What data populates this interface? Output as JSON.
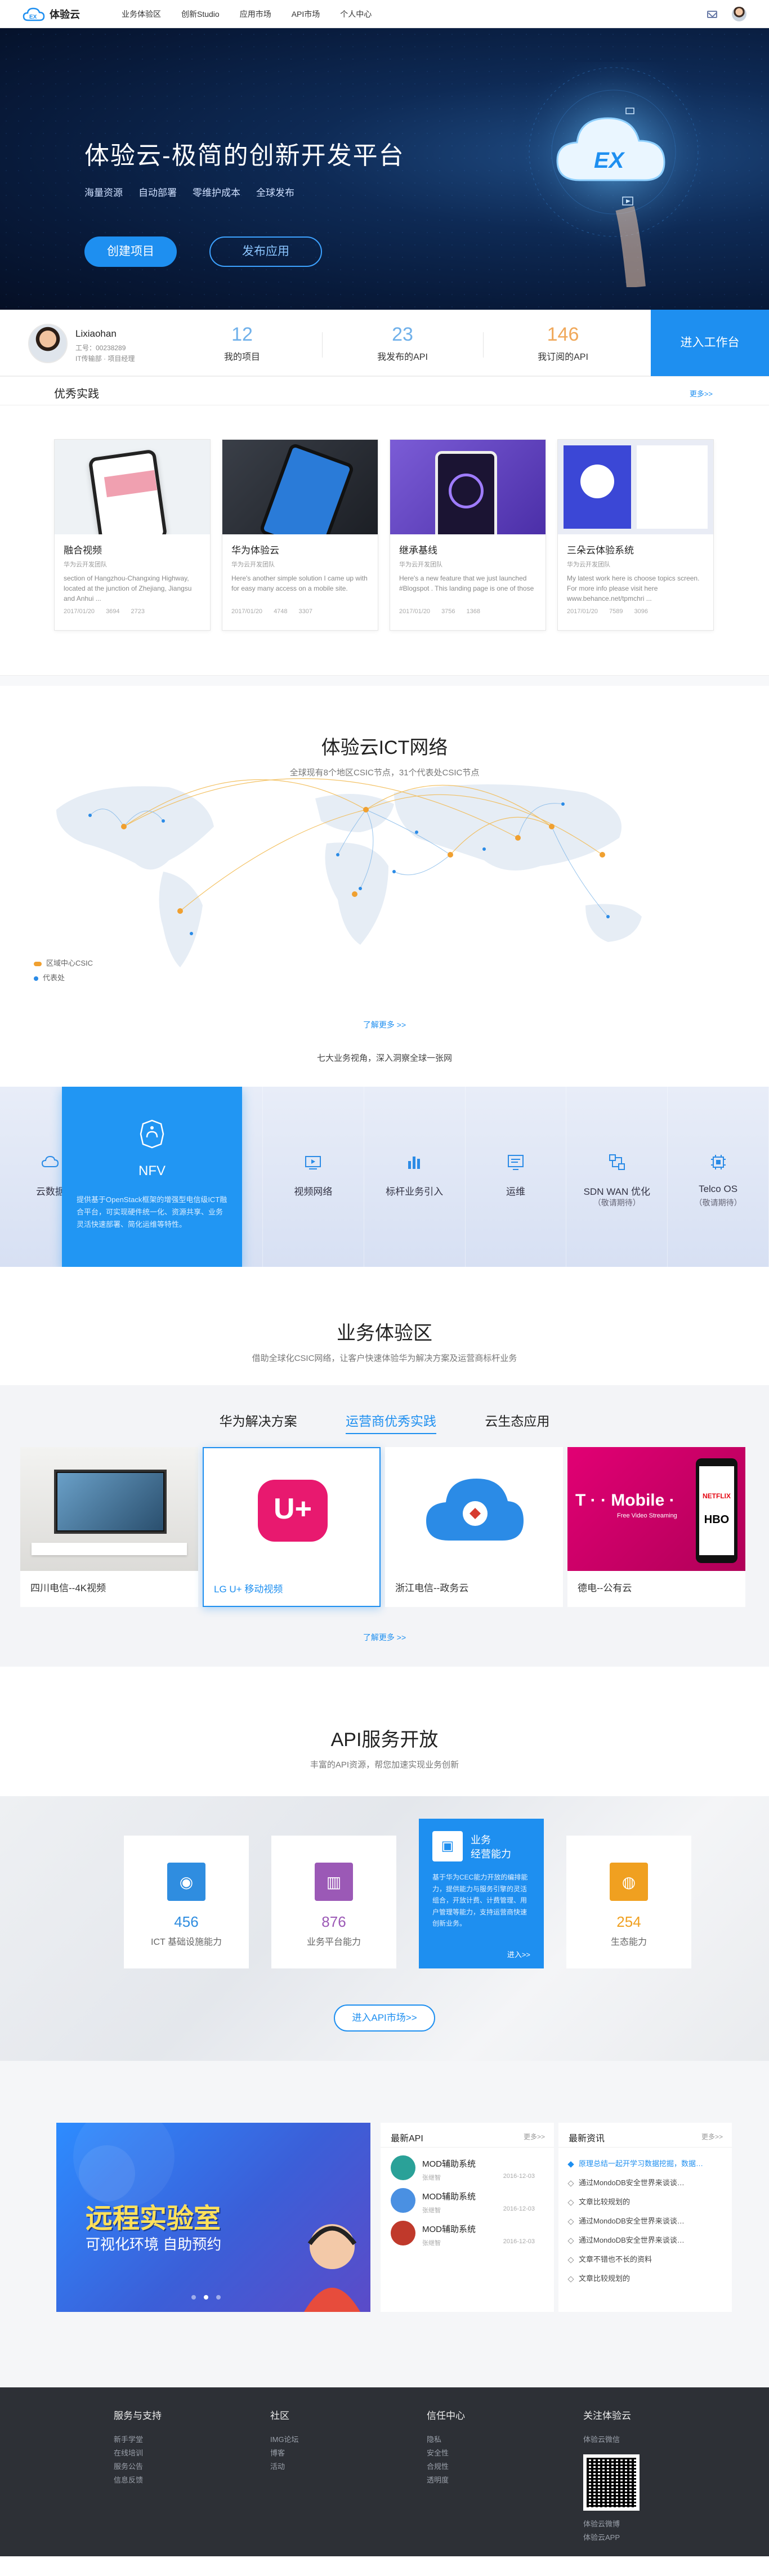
{
  "nav": {
    "logo": "体验云",
    "menu": [
      "业务体验区",
      "创新Studio",
      "应用市场",
      "API市场",
      "个人中心"
    ],
    "brand_color": "#1e8ff0"
  },
  "hero": {
    "title": "体验云-极简的创新开发平台",
    "subs": [
      "海量资源",
      "自动部署",
      "零维护成本",
      "全球发布"
    ],
    "btn_create": "创建项目",
    "btn_publish": "发布应用"
  },
  "user": {
    "name": "Lixiaohan",
    "id_line": "工号：00238289",
    "dept_line": "IT传输部 · 项目经理",
    "stats": [
      {
        "n": "12",
        "l": "我的项目"
      },
      {
        "n": "23",
        "l": "我发布的API"
      },
      {
        "n": "146",
        "l": "我订阅的API"
      }
    ],
    "work_btn": "进入工作台"
  },
  "practice": {
    "title": "优秀实践",
    "more": "更多>>",
    "cards": [
      {
        "title": "融合视频",
        "meta": "华为云开发团队",
        "desc": "section of Hangzhou-Changxing Highway, located at the junction of Zhejiang, Jiangsu and Anhui ...",
        "date": "2017/01/20",
        "views": "3694",
        "likes": "2723"
      },
      {
        "title": "华为体验云",
        "meta": "华为云开发团队",
        "desc": "Here's another simple solution I came up with for easy many access on a mobile site.",
        "date": "2017/01/20",
        "views": "4748",
        "likes": "3307"
      },
      {
        "title": "继承基线",
        "meta": "华为云开发团队",
        "desc": "Here's a new feature that we just launched #Blogspot . This landing page is one of those",
        "date": "2017/01/20",
        "views": "3756",
        "likes": "1368"
      },
      {
        "title": "三朵云体验系统",
        "meta": "华为云开发团队",
        "desc": "My latest work here is choose topics screen. For more info please visit here www.behance.net/tpmchri ...",
        "date": "2017/01/20",
        "views": "7589",
        "likes": "3096"
      }
    ]
  },
  "ict": {
    "title": "体验云ICT网络",
    "sub": "全球现有8个地区CSIC节点，31个代表处CSIC节点",
    "legend": [
      "区域中心CSIC",
      "代表处"
    ],
    "more": "了解更多 >>",
    "foot": "七大业务视角，深入洞察全球一张网"
  },
  "services": {
    "items": [
      {
        "lbl": "云数据"
      },
      {
        "lbl": "NFV",
        "desc": "提供基于OpenStack框架的增强型电信级ICT融合平台，可实现硬件统一化、资源共享、业务灵活快速部署、简化运维等特性。"
      },
      {
        "lbl": "视频网络"
      },
      {
        "lbl": "标杆业务引入"
      },
      {
        "lbl": "运维"
      },
      {
        "lbl": "SDN WAN 优化",
        "sub": "（敬请期待）"
      },
      {
        "lbl": "Telco OS",
        "sub": "（敬请期待）"
      }
    ]
  },
  "biz": {
    "title": "业务体验区",
    "sub": "借助全球化CSIC网络，让客户快速体验华为解决方案及运营商标杆业务",
    "tabs": [
      "华为解决方案",
      "运营商优秀实践",
      "云生态应用"
    ],
    "cards": [
      "四川电信--4K视频",
      "LG U+ 移动视频",
      "浙江电信--政务云",
      "德电--公有云"
    ],
    "more": "了解更多 >>",
    "lgu": "U+",
    "tmobile": "T · · Mobile ·",
    "tm_sub": "Free Video Streaming",
    "netflix": "NETFLIX",
    "hbo": "HBO"
  },
  "api": {
    "title": "API服务开放",
    "sub": "丰富的API资源，帮您加速实现业务创新",
    "cards": [
      {
        "n": "456",
        "l": "ICT 基础设施能力",
        "color": "#2f8de0"
      },
      {
        "n": "876",
        "l": "业务平台能力",
        "color": "#9b59b6"
      },
      {
        "hot_title": "业务\n经营能力",
        "hot_desc": "基于华为CEC能力开放的编排能力，提供能力与服务引擎的灵活组合，开放计费、计费管理、用户管理等能力，支持运营商快速创新业务。",
        "hot_more": "进入>>"
      },
      {
        "n": "254",
        "l": "生态能力",
        "color": "#f0a020"
      }
    ],
    "btn": "进入API市场>>"
  },
  "news": {
    "banner_title": "远程实验室",
    "banner_sub": "可视化环境 自助预约",
    "api_box": {
      "title": "最新API",
      "more": "更多>>",
      "rows": [
        {
          "name": "MOD辅助系统",
          "owner": "张继智",
          "date": "2016-12-03",
          "color": "#2aa198"
        },
        {
          "name": "MOD辅助系统",
          "owner": "张继智",
          "date": "2016-12-03",
          "color": "#4a90e2"
        },
        {
          "name": "MOD辅助系统",
          "owner": "张继智",
          "date": "2016-12-03",
          "color": "#c0392b"
        }
      ]
    },
    "news_box": {
      "title": "最新资讯",
      "more": "更多>>",
      "rows": [
        "原理总结一起开学习数据挖掘，数据…",
        "通过MondoDB安全世界来谈谈…",
        "文章比较规划的",
        "通过MondoDB安全世界来谈谈…",
        "通过MondoDB安全世界来谈谈…",
        "文章不错也不长的资料",
        "文章比较规划的"
      ]
    }
  },
  "footer": {
    "cols": [
      {
        "h": "服务与支持",
        "items": [
          "新手学堂",
          "在线培训",
          "服务公告",
          "信息反馈"
        ]
      },
      {
        "h": "社区",
        "items": [
          "IMG论坛",
          "博客",
          "活动"
        ]
      },
      {
        "h": "信任中心",
        "items": [
          "隐私",
          "安全性",
          "合规性",
          "透明度"
        ]
      },
      {
        "h": "关注体验云",
        "items": [
          "体验云微信",
          "体验云微博",
          "体验云APP"
        ]
      }
    ]
  }
}
